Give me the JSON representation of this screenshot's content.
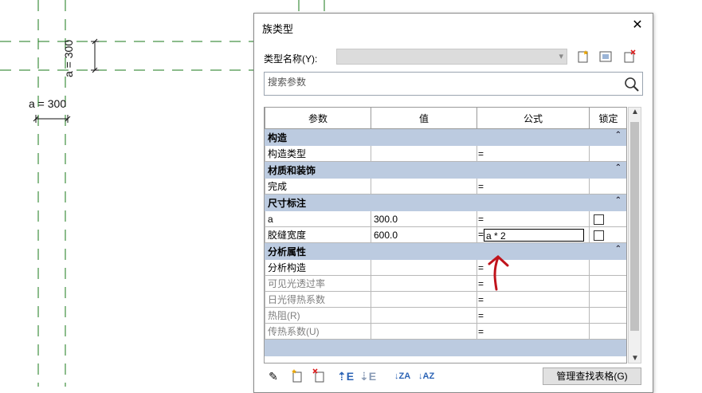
{
  "drawing": {
    "dim_vertical_label": "a = 300",
    "dim_horizontal_label": "a = 300"
  },
  "dialog": {
    "title": "族类型",
    "type_name_label": "类型名称(Y):",
    "search_placeholder": "搜索参数",
    "columns": [
      "参数",
      "值",
      "公式",
      "锁定"
    ],
    "groups": [
      {
        "name": "构造",
        "rows": [
          {
            "param": "构造类型",
            "value": "",
            "formula": "=",
            "lock": false
          }
        ]
      },
      {
        "name": "材质和装饰",
        "rows": [
          {
            "param": "完成",
            "value": "",
            "formula": "=",
            "lock": false
          }
        ]
      },
      {
        "name": "尺寸标注",
        "rows": [
          {
            "param": "a",
            "value": "300.0",
            "formula": "=",
            "lock": true
          },
          {
            "param": "胶缝宽度",
            "value": "600.0",
            "formula": "=",
            "formula_edit": "a * 2",
            "lock": true
          }
        ]
      },
      {
        "name": "分析属性",
        "rows": [
          {
            "param": "分析构造",
            "value": "",
            "formula": "="
          },
          {
            "param": "可见光透过率",
            "value": "",
            "formula": "="
          },
          {
            "param": "日光得热系数",
            "value": "",
            "formula": "="
          },
          {
            "param": "热阻(R)",
            "value": "",
            "formula": "="
          },
          {
            "param": "传热系数(U)",
            "value": "",
            "formula": "="
          }
        ]
      }
    ],
    "lookup_button": "管理查找表格(G)",
    "colors": {
      "group_header": "#bccbe0",
      "annotation_arrow": "#c0141c",
      "grid_line": "#1a7a1a"
    }
  }
}
